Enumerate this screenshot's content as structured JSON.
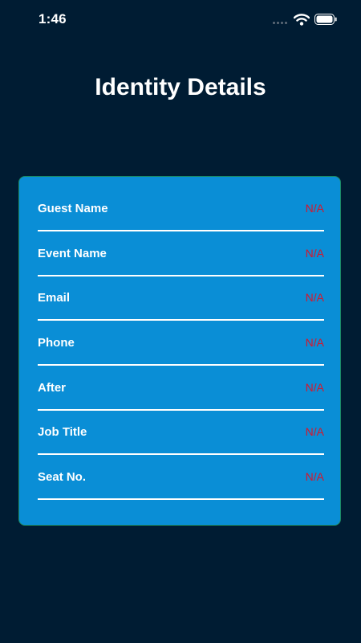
{
  "status_bar": {
    "time": "1:46",
    "icons": [
      "signal-dots-icon",
      "wifi-icon",
      "battery-icon"
    ]
  },
  "page": {
    "title": "Identity Details"
  },
  "colors": {
    "background": "#001c33",
    "card": "#0a8ed6",
    "card_border": "#1c8a63",
    "value_text": "#d8152a",
    "label_text": "#ffffff"
  },
  "details": [
    {
      "label": "Guest Name",
      "value": "N/A"
    },
    {
      "label": "Event Name",
      "value": "N/A"
    },
    {
      "label": "Email",
      "value": "N/A"
    },
    {
      "label": "Phone",
      "value": "N/A"
    },
    {
      "label": "After",
      "value": "N/A"
    },
    {
      "label": "Job Title",
      "value": "N/A"
    },
    {
      "label": "Seat No.",
      "value": "N/A"
    }
  ]
}
